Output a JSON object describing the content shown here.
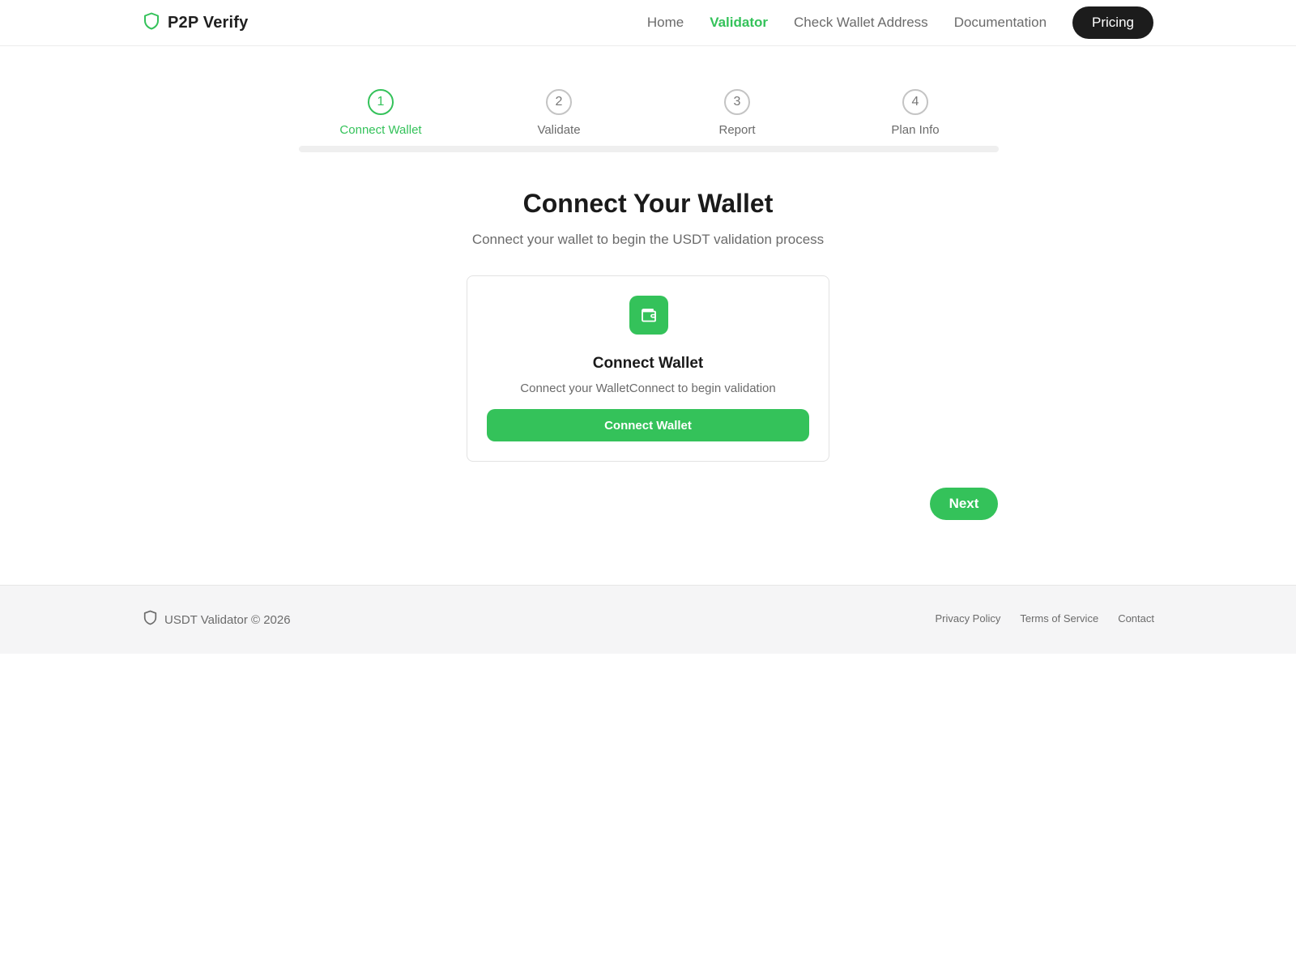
{
  "header": {
    "brand": "P2P Verify",
    "nav": {
      "home": "Home",
      "validator": "Validator",
      "check_wallet": "Check Wallet Address",
      "documentation": "Documentation",
      "pricing": "Pricing"
    },
    "active_nav": "Validator"
  },
  "stepper": {
    "steps": [
      {
        "number": "1",
        "label": "Connect Wallet"
      },
      {
        "number": "2",
        "label": "Validate"
      },
      {
        "number": "3",
        "label": "Report"
      },
      {
        "number": "4",
        "label": "Plan Info"
      }
    ],
    "current_step": 1,
    "progress_fraction": 0
  },
  "main": {
    "title": "Connect Your Wallet",
    "subtitle": "Connect your wallet to begin the USDT validation process",
    "card": {
      "icon": "wallet-icon",
      "title": "Connect Wallet",
      "description": "Connect your WalletConnect to begin validation",
      "button_label": "Connect Wallet"
    },
    "next_label": "Next"
  },
  "footer": {
    "icon": "shield-icon",
    "copyright": "USDT Validator © 2026",
    "links": {
      "privacy": "Privacy Policy",
      "terms": "Terms of Service",
      "contact": "Contact"
    }
  },
  "colors": {
    "accent": "#34c25a",
    "dark": "#1c1c1c",
    "muted_text": "#6b6b6b",
    "footer_bg": "#f5f5f6"
  }
}
